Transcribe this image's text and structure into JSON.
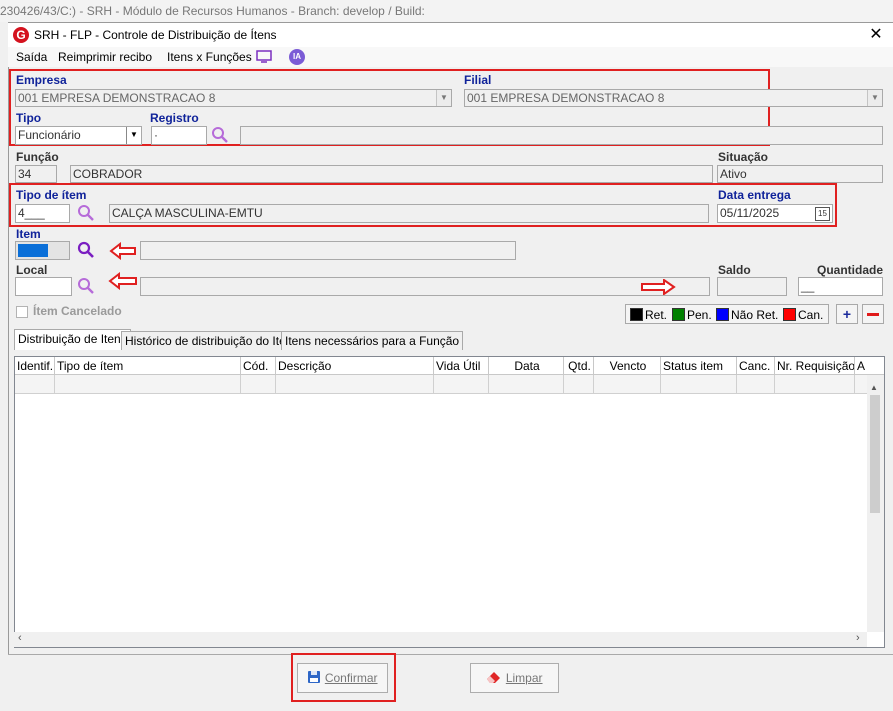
{
  "background_title": "230426/43/C:) - SRH - Módulo de Recursos Humanos - Branch: develop / Build:",
  "window": {
    "title": "SRH - FLP - Controle de Distribuição de Ítens",
    "logo": "G"
  },
  "menu": {
    "saida": "Saída",
    "reimprimir": "Reimprimir recibo",
    "itens_funcoes": "Itens x Funções",
    "ia": "IA"
  },
  "empresa": {
    "label": "Empresa",
    "value": "001 EMPRESA DEMONSTRACAO 8"
  },
  "filial": {
    "label": "Filial",
    "value": "001 EMPRESA DEMONSTRACAO 8"
  },
  "tipo": {
    "label": "Tipo",
    "value": "Funcionário"
  },
  "registro": {
    "label": "Registro",
    "value": "·",
    "name_value": ""
  },
  "funcao": {
    "label": "Função",
    "code": "34",
    "name": "COBRADOR"
  },
  "situacao": {
    "label": "Situação",
    "value": "Ativo"
  },
  "tipo_item": {
    "label": "Tipo de ítem",
    "code": "4___",
    "name": "CALÇA MASCULINA-EMTU"
  },
  "data_entrega": {
    "label": "Data entrega",
    "value": "05/11/2025",
    "cal": "15"
  },
  "item": {
    "label": "Item",
    "value": ""
  },
  "local": {
    "label": "Local",
    "value": ""
  },
  "saldo": {
    "label": "Saldo",
    "value": ""
  },
  "quantidade": {
    "label": "Quantidade",
    "value": "__"
  },
  "item_cancelado": {
    "label": "Ítem Cancelado",
    "checked": false
  },
  "legend": [
    {
      "label": "Ret.",
      "color": "#000000"
    },
    {
      "label": "Pen.",
      "color": "#008000"
    },
    {
      "label": "Não Ret.",
      "color": "#0000ff"
    },
    {
      "label": "Can.",
      "color": "#ff0000"
    }
  ],
  "buttons": {
    "add": "+",
    "remove": "−",
    "confirmar": "Confirmar",
    "limpar": "Limpar"
  },
  "tabs": [
    "Distribuição de Itens",
    "Histórico de distribuição do Item",
    "Itens necessários para a Função"
  ],
  "grid": {
    "columns": [
      "Identif.",
      "Tipo de ítem",
      "Cód.",
      "Descrição",
      "Vida Útil",
      "Data",
      "Qtd.",
      "Vencto",
      "Status item",
      "Canc.",
      "Nr. Requisição",
      "A"
    ]
  },
  "colors": {
    "accent_red": "#e02020",
    "label_blue": "#10239a",
    "search_purple": "#9b3cc9"
  }
}
